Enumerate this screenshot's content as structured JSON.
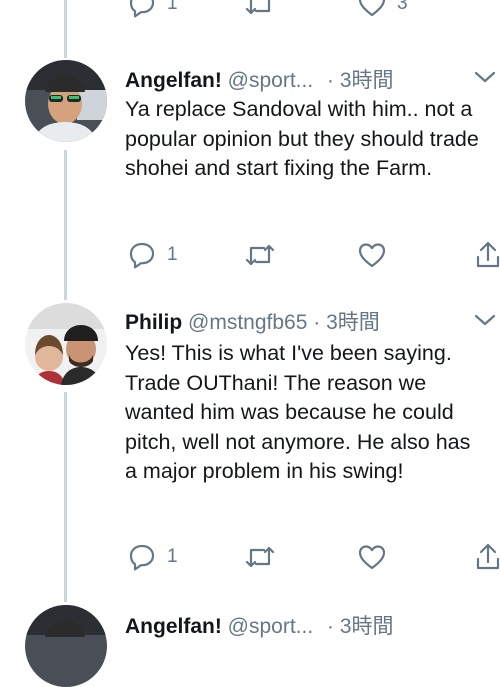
{
  "tweets": [
    {
      "name": "Angelfan!",
      "handle": "@sport...",
      "separator": "·",
      "time": "3時間",
      "text": "Ya replace Sandoval with him.. not a popular opinion but they should trade shohei and start fixing the Farm.",
      "reply_count": "1"
    },
    {
      "name": "Philip",
      "handle": "@mstngfb65",
      "separator": "·",
      "time": "3時間",
      "text": "Yes! This is what I've been saying. Trade OUThani! The reason we wanted him was because he could pitch, well not anymore. He also has a major problem in his swing!",
      "reply_count": "1"
    },
    {
      "name": "Angelfan!",
      "handle": "@sport...",
      "separator": "·",
      "time": "3時間"
    }
  ],
  "top_partial": {
    "reply_count": "1",
    "like_count": "3"
  },
  "icons": [
    "reply-icon",
    "retweet-icon",
    "like-icon",
    "share-icon",
    "chevron-down-icon"
  ],
  "colors": {
    "text": "#14171a",
    "secondary": "#657786",
    "thread_line": "#ccd6dd",
    "background": "#ffffff"
  }
}
